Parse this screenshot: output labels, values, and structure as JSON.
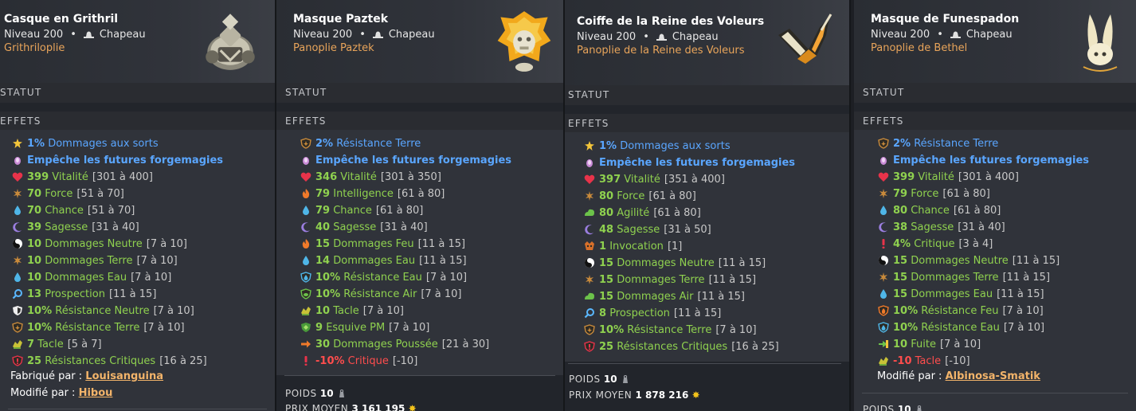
{
  "sections": {
    "statut": "STATUT",
    "effets": "EFFETS"
  },
  "cards": [
    {
      "name": "Casque en Grithril",
      "level": "Niveau 200",
      "type": "Chapeau",
      "set": "Grithriloplie",
      "statut_label": "STATUT",
      "effets_label": "EFFETS",
      "effects": [
        {
          "icon": "dommages-icon",
          "value": "1%",
          "label": "Dommages aux sorts",
          "range": "",
          "color": "blue"
        },
        {
          "icon": "forgemagie-icon",
          "value": "",
          "label": "Empêche les futures forgemagies",
          "range": "",
          "color": "blue"
        },
        {
          "icon": "vitalite-icon",
          "value": "399",
          "label": "Vitalité",
          "range": "[301 à 400]",
          "color": "green"
        },
        {
          "icon": "force-icon",
          "value": "70",
          "label": "Force",
          "range": "[51 à 70]",
          "color": "green"
        },
        {
          "icon": "chance-icon",
          "value": "70",
          "label": "Chance",
          "range": "[51 à 70]",
          "color": "green"
        },
        {
          "icon": "sagesse-icon",
          "value": "39",
          "label": "Sagesse",
          "range": "[31 à 40]",
          "color": "green"
        },
        {
          "icon": "neutre-icon",
          "value": "10",
          "label": "Dommages Neutre",
          "range": "[7 à 10]",
          "color": "green"
        },
        {
          "icon": "force-icon",
          "value": "10",
          "label": "Dommages Terre",
          "range": "[7 à 10]",
          "color": "green"
        },
        {
          "icon": "chance-icon",
          "value": "10",
          "label": "Dommages Eau",
          "range": "[7 à 10]",
          "color": "green"
        },
        {
          "icon": "prospection-icon",
          "value": "13",
          "label": "Prospection",
          "range": "[11 à 15]",
          "color": "green"
        },
        {
          "icon": "res-neutre-icon",
          "value": "10%",
          "label": "Résistance Neutre",
          "range": "[7 à 10]",
          "color": "green"
        },
        {
          "icon": "res-terre-icon",
          "value": "10%",
          "label": "Résistance Terre",
          "range": "[7 à 10]",
          "color": "green"
        },
        {
          "icon": "tacle-icon",
          "value": "7",
          "label": "Tacle",
          "range": "[5 à 7]",
          "color": "green"
        },
        {
          "icon": "res-critique-icon",
          "value": "25",
          "label": "Résistances Critiques",
          "range": "[16 à 25]",
          "color": "green"
        }
      ],
      "crafted_label": "Fabriqué par :",
      "crafted_by": "Louisanguina",
      "modified_label": "Modifié par :",
      "modified_by": "Hibou"
    },
    {
      "name": "Masque Paztek",
      "level": "Niveau 200",
      "type": "Chapeau",
      "set": "Panoplie Paztek",
      "statut_label": "STATUT",
      "effets_label": "EFFETS",
      "effects": [
        {
          "icon": "res-terre-icon",
          "value": "2%",
          "label": "Résistance Terre",
          "range": "",
          "color": "blue"
        },
        {
          "icon": "forgemagie-icon",
          "value": "",
          "label": "Empêche les futures forgemagies",
          "range": "",
          "color": "blue"
        },
        {
          "icon": "vitalite-icon",
          "value": "346",
          "label": "Vitalité",
          "range": "[301 à 350]",
          "color": "green"
        },
        {
          "icon": "intelligence-icon",
          "value": "79",
          "label": "Intelligence",
          "range": "[61 à 80]",
          "color": "green"
        },
        {
          "icon": "chance-icon",
          "value": "79",
          "label": "Chance",
          "range": "[61 à 80]",
          "color": "green"
        },
        {
          "icon": "sagesse-icon",
          "value": "40",
          "label": "Sagesse",
          "range": "[31 à 40]",
          "color": "green"
        },
        {
          "icon": "intelligence-icon",
          "value": "15",
          "label": "Dommages Feu",
          "range": "[11 à 15]",
          "color": "green"
        },
        {
          "icon": "chance-icon",
          "value": "14",
          "label": "Dommages Eau",
          "range": "[11 à 15]",
          "color": "green"
        },
        {
          "icon": "res-eau-icon",
          "value": "10%",
          "label": "Résistance Eau",
          "range": "[7 à 10]",
          "color": "green"
        },
        {
          "icon": "res-air-icon",
          "value": "10%",
          "label": "Résistance Air",
          "range": "[7 à 10]",
          "color": "green"
        },
        {
          "icon": "tacle-icon",
          "value": "10",
          "label": "Tacle",
          "range": "[7 à 10]",
          "color": "green"
        },
        {
          "icon": "esquive-icon",
          "value": "9",
          "label": "Esquive PM",
          "range": "[7 à 10]",
          "color": "green"
        },
        {
          "icon": "poussee-icon",
          "value": "30",
          "label": "Dommages Poussée",
          "range": "[21 à 30]",
          "color": "green"
        },
        {
          "icon": "critique-icon",
          "value": "-10%",
          "label": "Critique",
          "range": "[-10]",
          "color": "red"
        }
      ],
      "poids_label": "POIDS",
      "poids": "10",
      "prix_label": "PRIX MOYEN",
      "prix": "3 161 195"
    },
    {
      "name": "Coiffe de la Reine des Voleurs",
      "level": "Niveau 200",
      "type": "Chapeau",
      "set": "Panoplie de la Reine des Voleurs",
      "statut_label": "STATUT",
      "effets_label": "EFFETS",
      "effects": [
        {
          "icon": "dommages-icon",
          "value": "1%",
          "label": "Dommages aux sorts",
          "range": "",
          "color": "blue"
        },
        {
          "icon": "forgemagie-icon",
          "value": "",
          "label": "Empêche les futures forgemagies",
          "range": "",
          "color": "blue"
        },
        {
          "icon": "vitalite-icon",
          "value": "397",
          "label": "Vitalité",
          "range": "[351 à 400]",
          "color": "green"
        },
        {
          "icon": "force-icon",
          "value": "80",
          "label": "Force",
          "range": "[61 à 80]",
          "color": "green"
        },
        {
          "icon": "agilite-icon",
          "value": "80",
          "label": "Agilité",
          "range": "[61 à 80]",
          "color": "green"
        },
        {
          "icon": "sagesse-icon",
          "value": "48",
          "label": "Sagesse",
          "range": "[31 à 50]",
          "color": "green"
        },
        {
          "icon": "invocation-icon",
          "value": "1",
          "label": "Invocation",
          "range": "[1]",
          "color": "green"
        },
        {
          "icon": "neutre-icon",
          "value": "15",
          "label": "Dommages Neutre",
          "range": "[11 à 15]",
          "color": "green"
        },
        {
          "icon": "force-icon",
          "value": "15",
          "label": "Dommages Terre",
          "range": "[11 à 15]",
          "color": "green"
        },
        {
          "icon": "agilite-icon",
          "value": "15",
          "label": "Dommages Air",
          "range": "[11 à 15]",
          "color": "green"
        },
        {
          "icon": "prospection-icon",
          "value": "8",
          "label": "Prospection",
          "range": "[11 à 15]",
          "color": "green"
        },
        {
          "icon": "res-terre-icon",
          "value": "10%",
          "label": "Résistance Terre",
          "range": "[7 à 10]",
          "color": "green"
        },
        {
          "icon": "res-critique-icon",
          "value": "25",
          "label": "Résistances Critiques",
          "range": "[16 à 25]",
          "color": "green"
        }
      ],
      "poids_label": "POIDS",
      "poids": "10",
      "prix_label": "PRIX MOYEN",
      "prix": "1 878 216"
    },
    {
      "name": "Masque de Funespadon",
      "level": "Niveau 200",
      "type": "Chapeau",
      "set": "Panoplie de Bethel",
      "statut_label": "STATUT",
      "effets_label": "EFFETS",
      "effects": [
        {
          "icon": "res-terre-icon",
          "value": "2%",
          "label": "Résistance Terre",
          "range": "",
          "color": "blue"
        },
        {
          "icon": "forgemagie-icon",
          "value": "",
          "label": "Empêche les futures forgemagies",
          "range": "",
          "color": "blue"
        },
        {
          "icon": "vitalite-icon",
          "value": "399",
          "label": "Vitalité",
          "range": "[301 à 400]",
          "color": "green"
        },
        {
          "icon": "force-icon",
          "value": "79",
          "label": "Force",
          "range": "[61 à 80]",
          "color": "green"
        },
        {
          "icon": "chance-icon",
          "value": "80",
          "label": "Chance",
          "range": "[61 à 80]",
          "color": "green"
        },
        {
          "icon": "sagesse-icon",
          "value": "38",
          "label": "Sagesse",
          "range": "[31 à 40]",
          "color": "green"
        },
        {
          "icon": "critique-icon",
          "value": "4%",
          "label": "Critique",
          "range": "[3 à 4]",
          "color": "green"
        },
        {
          "icon": "neutre-icon",
          "value": "15",
          "label": "Dommages Neutre",
          "range": "[11 à 15]",
          "color": "green"
        },
        {
          "icon": "force-icon",
          "value": "15",
          "label": "Dommages Terre",
          "range": "[11 à 15]",
          "color": "green"
        },
        {
          "icon": "chance-icon",
          "value": "15",
          "label": "Dommages Eau",
          "range": "[11 à 15]",
          "color": "green"
        },
        {
          "icon": "res-feu-icon",
          "value": "10%",
          "label": "Résistance Feu",
          "range": "[7 à 10]",
          "color": "green"
        },
        {
          "icon": "res-eau-icon",
          "value": "10%",
          "label": "Résistance Eau",
          "range": "[7 à 10]",
          "color": "green"
        },
        {
          "icon": "fuite-icon",
          "value": "10",
          "label": "Fuite",
          "range": "[7 à 10]",
          "color": "green"
        },
        {
          "icon": "tacle-icon",
          "value": "-10",
          "label": "Tacle",
          "range": "[-10]",
          "color": "red"
        }
      ],
      "modified_label": "Modifié par :",
      "modified_by": "Albinosa-Smatik",
      "poids_label": "POIDS",
      "poids": "10"
    }
  ]
}
